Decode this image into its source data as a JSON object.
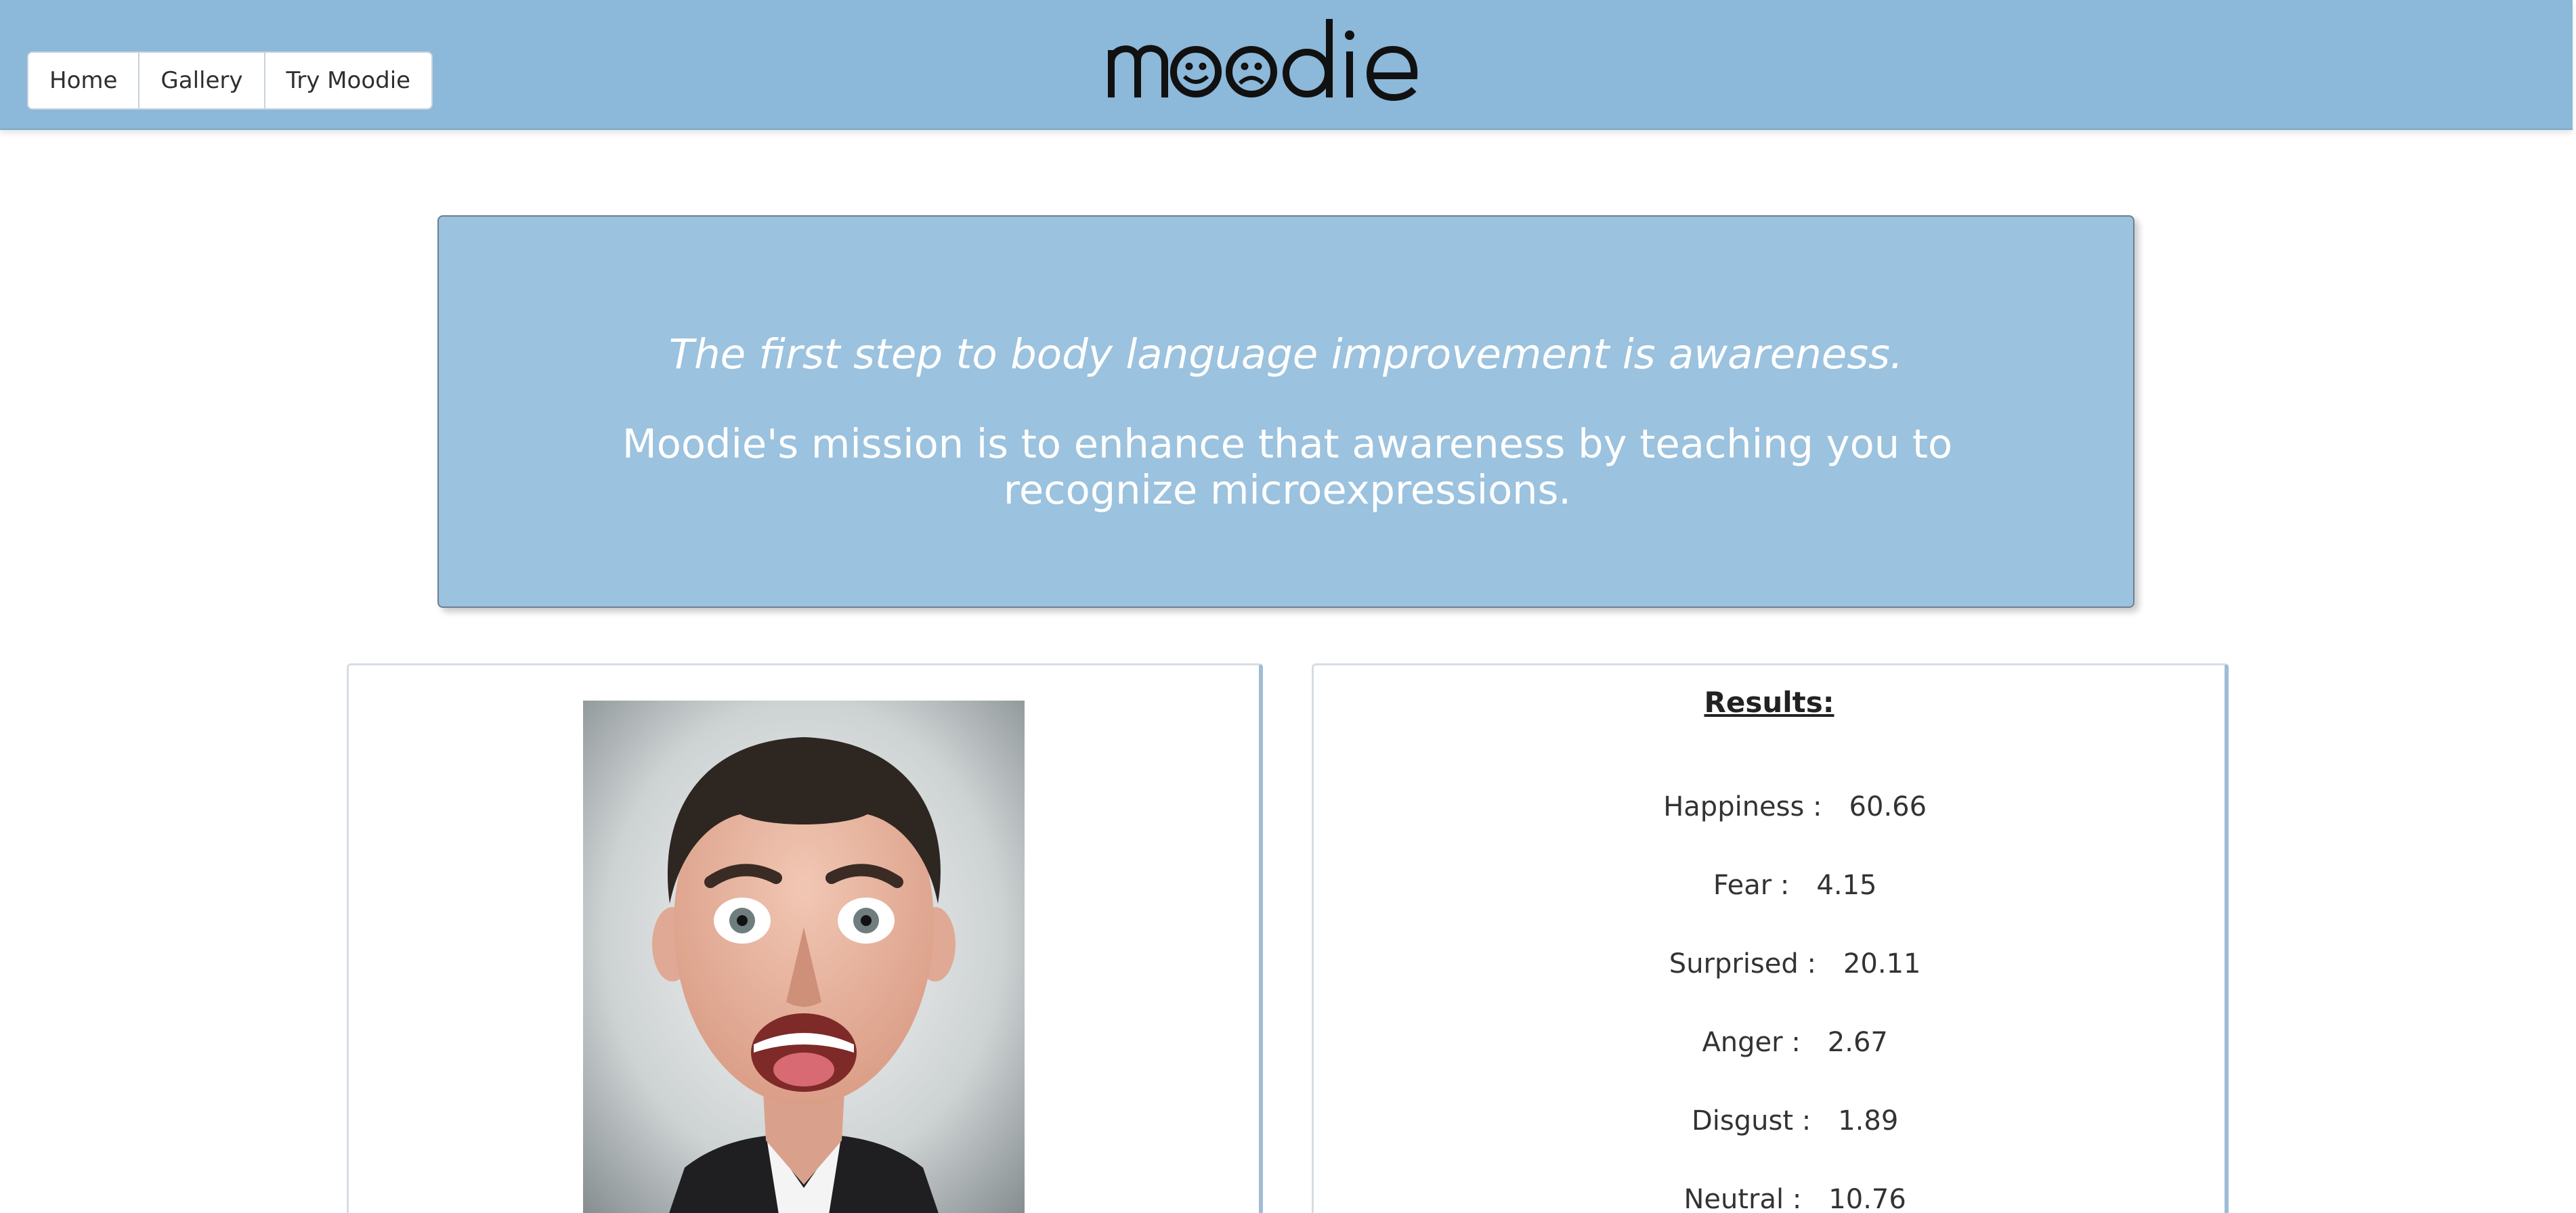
{
  "nav": {
    "items": [
      {
        "label": "Home"
      },
      {
        "label": "Gallery"
      },
      {
        "label": "Try Moodie"
      }
    ]
  },
  "brand": {
    "logo_text": "moodie"
  },
  "hero": {
    "quote": "The first step to body language improvement is awareness.",
    "mission": "Moodie's mission is to enhance that awareness by teaching you to recognize microexpressions."
  },
  "results": {
    "title": "Results:",
    "items": [
      {
        "label": "Happiness :",
        "value": "60.66"
      },
      {
        "label": "Fear :",
        "value": "4.15"
      },
      {
        "label": "Surprised :",
        "value": "20.11"
      },
      {
        "label": "Anger :",
        "value": "2.67"
      },
      {
        "label": "Disgust :",
        "value": "1.89"
      },
      {
        "label": "Neutral :",
        "value": "10.76"
      }
    ]
  },
  "colors": {
    "header": "#8cb8d9",
    "hero": "#9bc2de",
    "text_white": "#ffffff"
  }
}
